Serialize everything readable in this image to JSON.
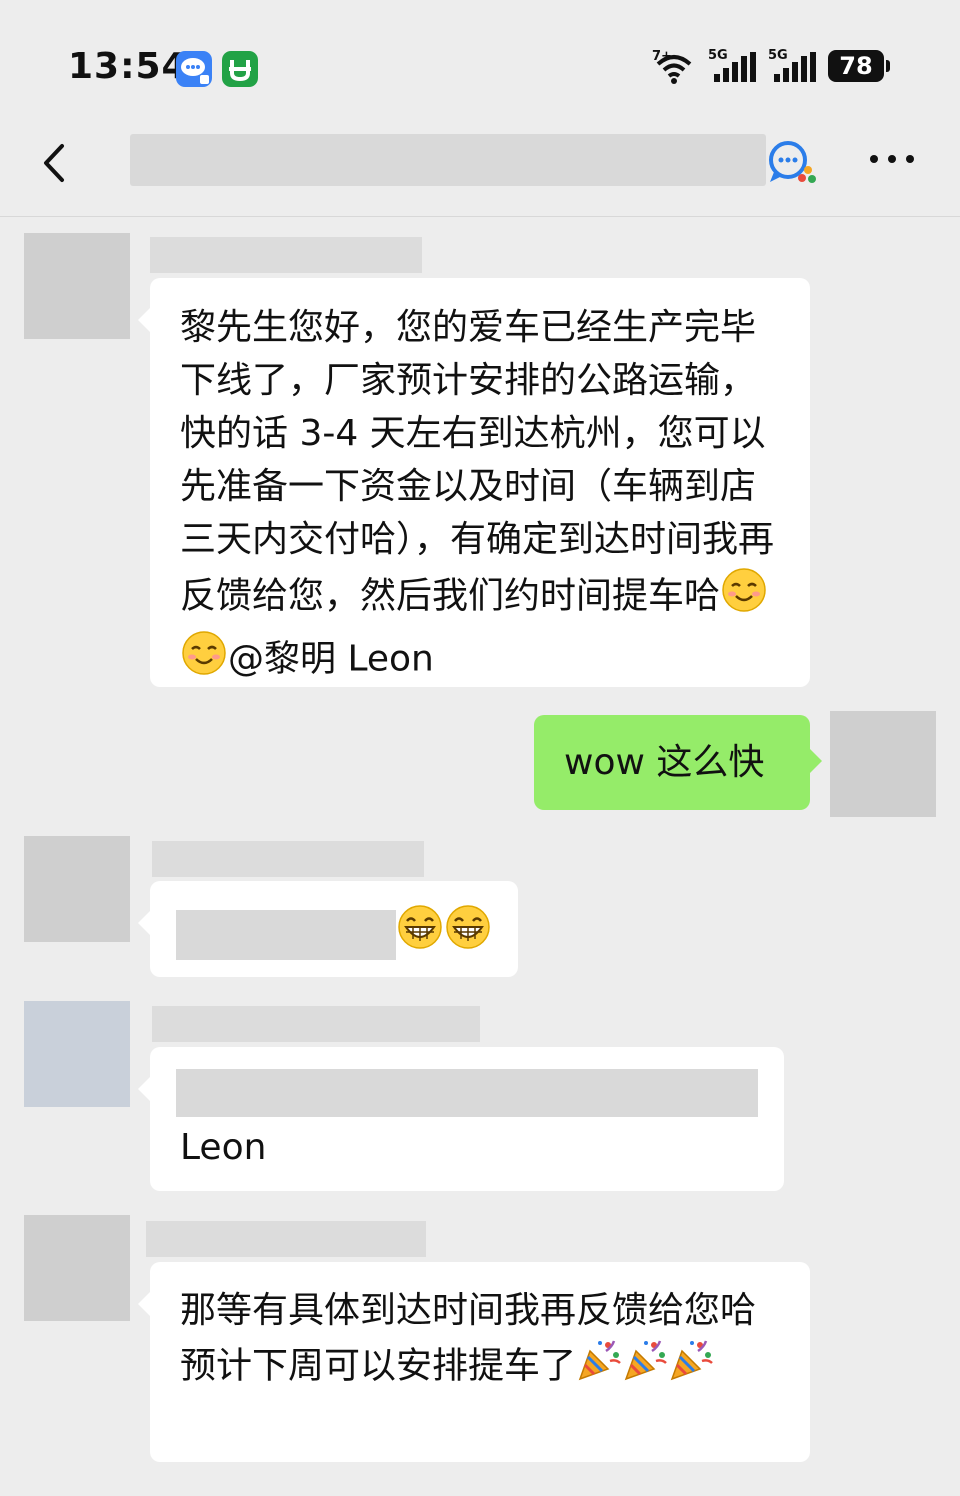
{
  "status_bar": {
    "time": "13:54",
    "wifi_label": "7+",
    "sim1": "5G",
    "sim2": "5G",
    "battery": "78"
  },
  "header": {
    "back": "back-icon",
    "chat_icon": "chat-bubbles-icon",
    "more": "more-icon"
  },
  "messages": [
    {
      "side": "left",
      "text": "黎先生您好，您的爱车已经生产完毕下线了，厂家预计安排的公路运输，快的话 3-4 天左右到达杭州，您可以先准备一下资金以及时间（车辆到店三天内交付哈），有确定到达时间我再反馈给您，然后我们约时间提车哈",
      "mention": "@黎明 Leon"
    },
    {
      "side": "right",
      "text": "wow 这么快"
    },
    {
      "side": "left",
      "emoji": "grinning-face-icon"
    },
    {
      "side": "left",
      "text": "Leon"
    },
    {
      "side": "left",
      "text": "那等有具体到达时间我再反馈给您哈 预计下周可以安排提车了",
      "emoji": "party-popper-icon"
    }
  ]
}
